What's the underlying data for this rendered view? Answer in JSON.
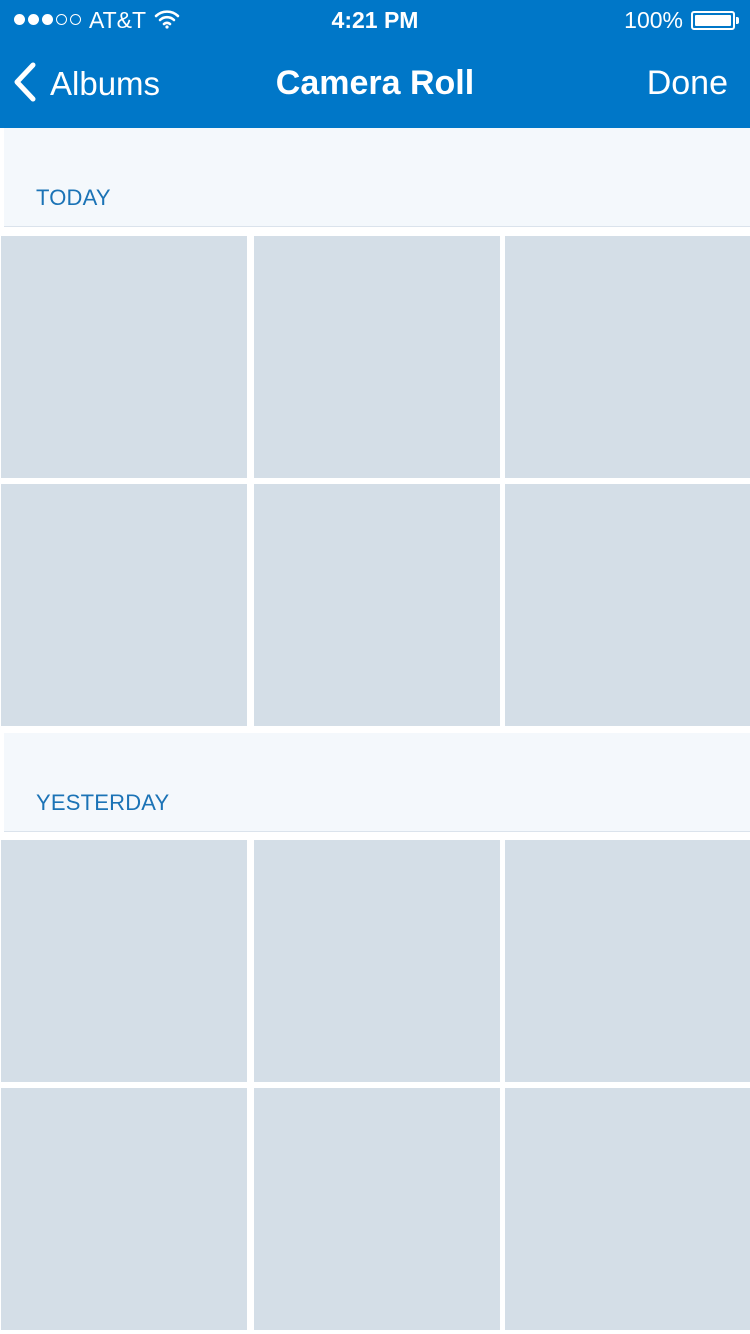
{
  "status_bar": {
    "carrier": "AT&T",
    "time": "4:21 PM",
    "battery_percent": "100%",
    "battery_level": 1.0,
    "signal_bars_filled": 3,
    "signal_bars_total": 5
  },
  "nav_bar": {
    "back_label": "Albums",
    "title": "Camera Roll",
    "done_label": "Done"
  },
  "sections": [
    {
      "title": "TODAY",
      "photo_count": 6
    },
    {
      "title": "YESTERDAY",
      "photo_count": 6
    }
  ],
  "colors": {
    "nav_background": "#0077c8",
    "section_title": "#1b73b6",
    "section_background": "#f4f8fc",
    "thumbnail_placeholder": "#d4dee7"
  },
  "icons": {
    "back": "chevron-left-icon",
    "wifi": "wifi-icon",
    "battery": "battery-icon",
    "signal": "signal-dots-icon"
  }
}
